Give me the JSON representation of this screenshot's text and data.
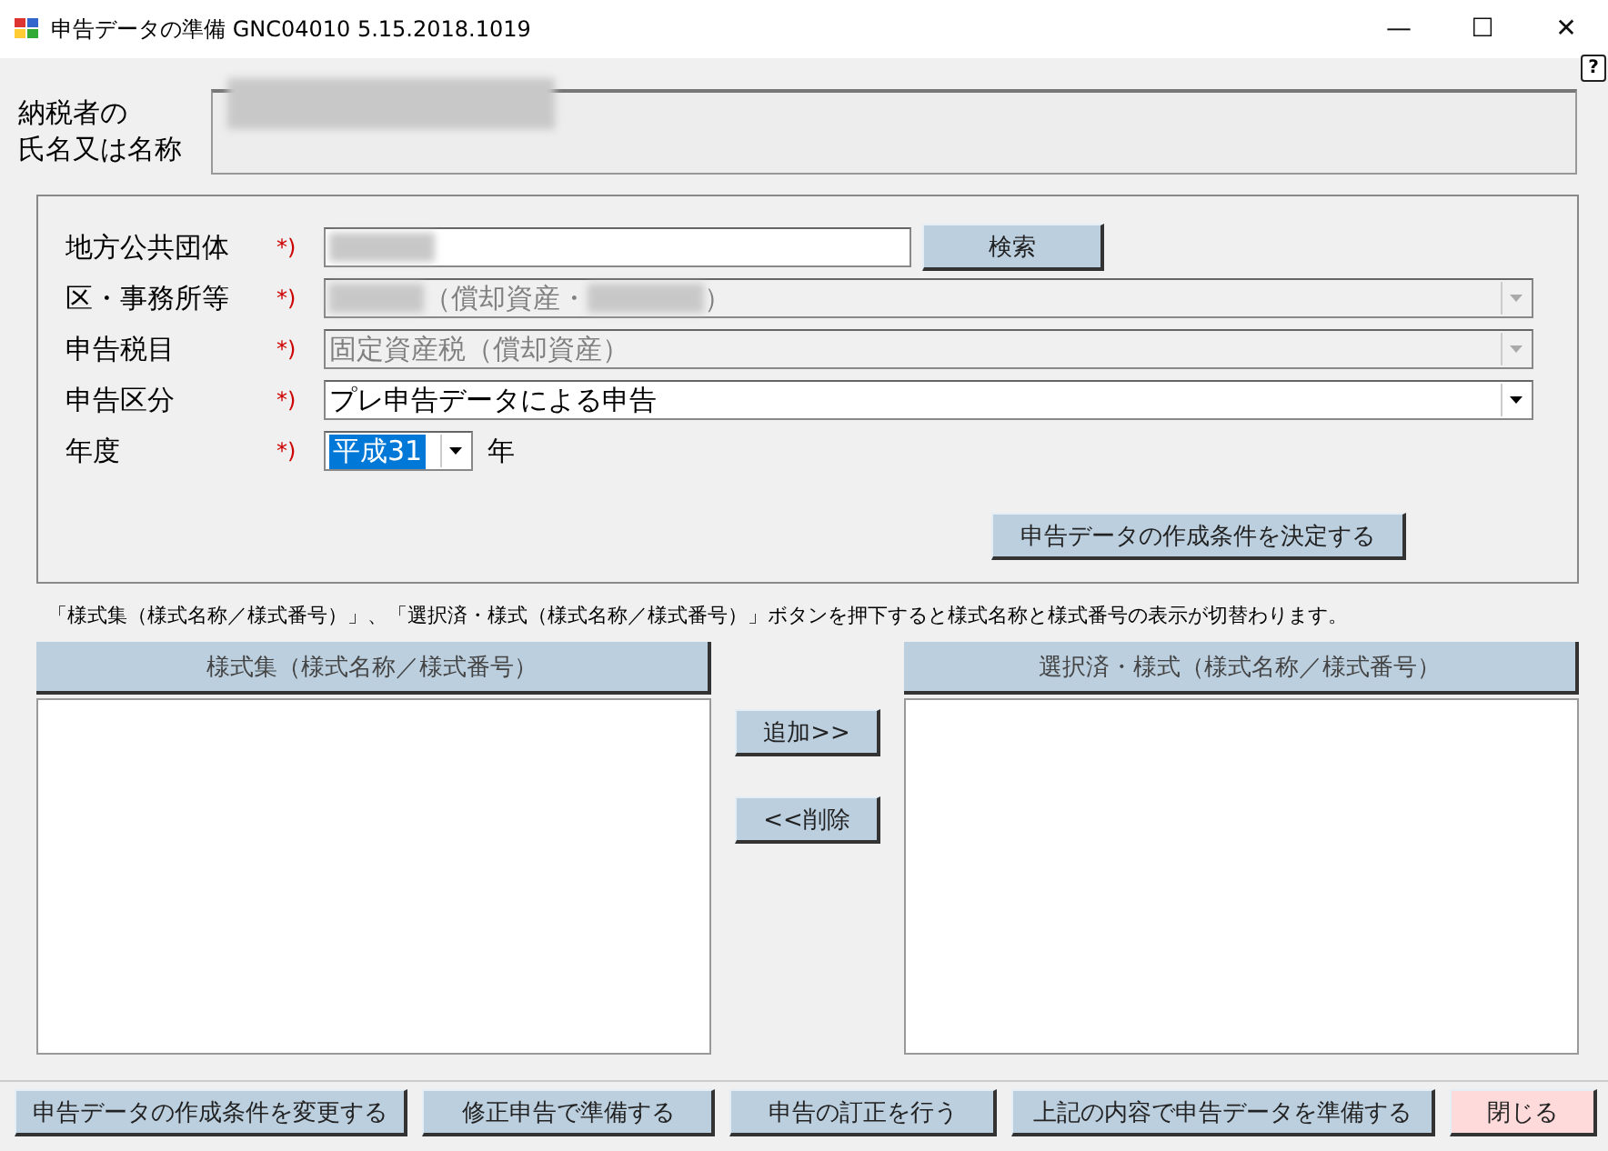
{
  "window": {
    "title": "申告データの準備 GNC04010  5.15.2018.1019",
    "controls": [
      "—",
      "☐",
      "✕"
    ]
  },
  "help": {
    "label": "?"
  },
  "taxpayer": {
    "label_lines": [
      "納税者の",
      "氏名又は名称"
    ],
    "redacted": true
  },
  "form": {
    "fields": [
      {
        "label": "地方公共団体",
        "required": "*)",
        "kind": "text",
        "redacted": true,
        "disabled": false,
        "button": "検索"
      },
      {
        "label": "区・事務所等",
        "required": "*)",
        "kind": "combo",
        "value": "（償却資産・",
        "suffix": "）",
        "redacted": true,
        "disabled": true
      },
      {
        "label": "申告税目",
        "required": "*)",
        "kind": "combo",
        "value": "固定資産税（償却資産）",
        "redacted": false,
        "disabled": true
      },
      {
        "label": "申告区分",
        "required": "*)",
        "kind": "combo",
        "value": "プレ申告データによる申告",
        "redacted": false,
        "disabled": false
      },
      {
        "label": "年度",
        "required": "*)",
        "kind": "year",
        "value": "平成31",
        "unit": "年",
        "redacted": false,
        "disabled": false
      }
    ],
    "decide_button": "申告データの作成条件を決定する"
  },
  "note": "「様式集（様式名称／様式番号）」、「選択済・様式（様式名称／様式番号）」ボタンを押下すると様式名称と様式番号の表示が切替わります。",
  "lists": {
    "left_header": "様式集（様式名称／様式番号）",
    "right_header": "選択済・様式（様式名称／様式番号）",
    "add_button": "追加>>",
    "remove_button": "<<削除"
  },
  "bottom_buttons": [
    {
      "label": "申告データの作成条件を変更する",
      "kind": "normal"
    },
    {
      "label": "修正申告で準備する",
      "kind": "normal"
    },
    {
      "label": "申告の訂正を行う",
      "kind": "normal"
    },
    {
      "label": "上記の内容で申告データを準備する",
      "kind": "normal"
    },
    {
      "label": "閉じる",
      "kind": "close"
    }
  ]
}
